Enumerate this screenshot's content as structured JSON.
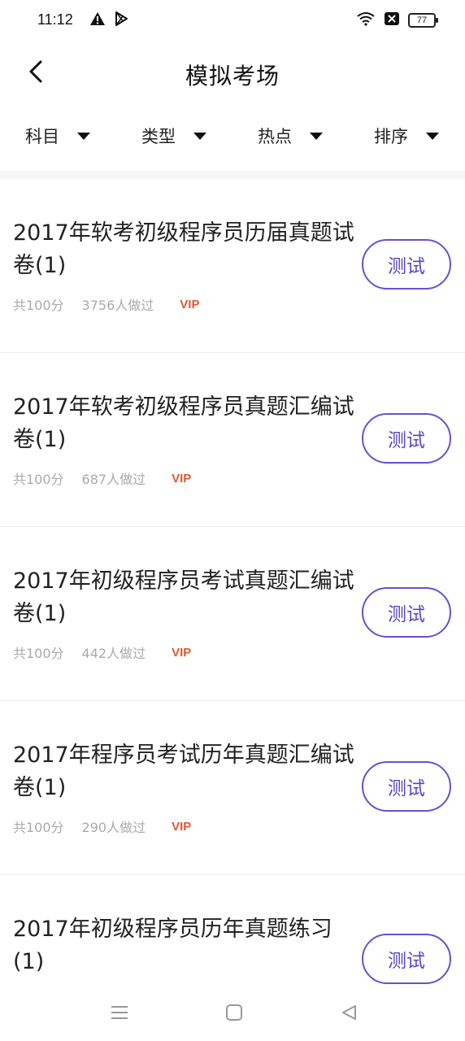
{
  "status_bar": {
    "time": "11:12",
    "battery": "77",
    "icons": [
      "warning-icon",
      "play-store-icon",
      "wifi-icon",
      "sim-off-icon",
      "battery-icon"
    ]
  },
  "header": {
    "title": "模拟考场",
    "back_icon": "chevron-left-icon"
  },
  "filters": [
    {
      "label": "科目"
    },
    {
      "label": "类型"
    },
    {
      "label": "热点"
    },
    {
      "label": "排序"
    }
  ],
  "items": [
    {
      "title": "2017年软考初级程序员历届真题试卷(1)",
      "score": "共100分",
      "count": "3756人做过",
      "badge": "VIP",
      "button": "测试"
    },
    {
      "title": "2017年软考初级程序员真题汇编试卷(1)",
      "score": "共100分",
      "count": "687人做过",
      "badge": "VIP",
      "button": "测试"
    },
    {
      "title": "2017年初级程序员考试真题汇编试卷(1)",
      "score": "共100分",
      "count": "442人做过",
      "badge": "VIP",
      "button": "测试"
    },
    {
      "title": "2017年程序员考试历年真题汇编试卷(1)",
      "score": "共100分",
      "count": "290人做过",
      "badge": "VIP",
      "button": "测试"
    },
    {
      "title": "2017年初级程序员历年真题练习(1)",
      "score": "",
      "count": "",
      "badge": "",
      "button": "测试"
    }
  ],
  "colors": {
    "accent": "#5b45c7",
    "vip": "#e0582f",
    "meta_text": "#aaaaaa"
  },
  "nav_bar": {
    "icons": [
      "menu-icon",
      "home-square-icon",
      "back-triangle-icon"
    ]
  }
}
